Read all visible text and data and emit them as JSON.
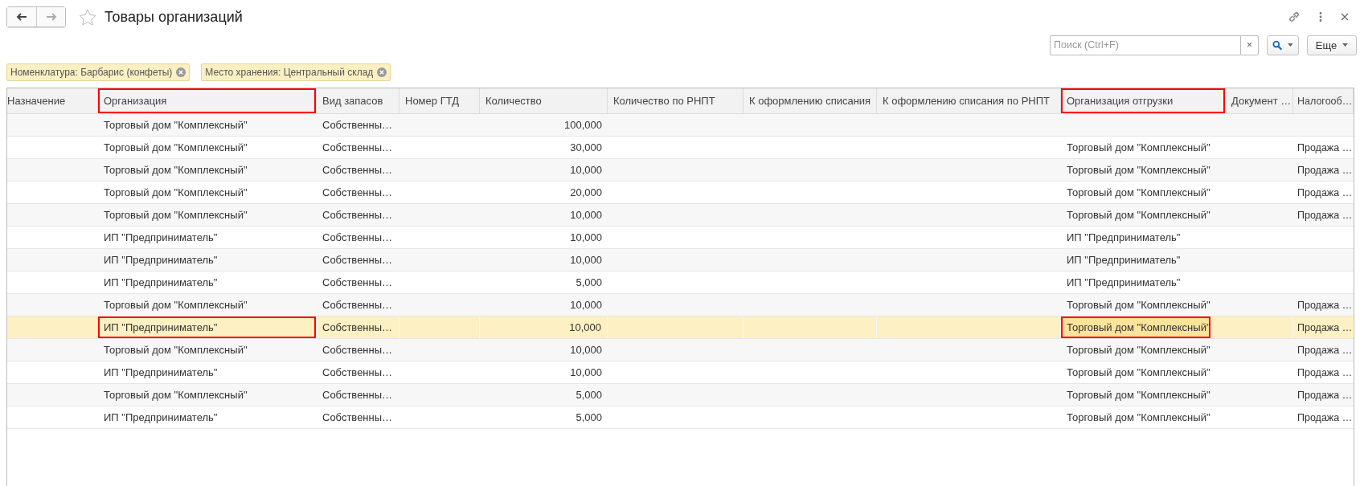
{
  "window": {
    "title": "Товары организаций"
  },
  "search": {
    "placeholder": "Поиск (Ctrl+F)",
    "clear": "×"
  },
  "more_button": "Еще",
  "filters": [
    {
      "label": "Номенклатура: Барбарис (конфеты)"
    },
    {
      "label": "Место хранения: Центральный склад"
    }
  ],
  "table": {
    "columns": [
      {
        "label": "Назначение",
        "annotated": false
      },
      {
        "label": "Организация",
        "annotated": true
      },
      {
        "label": "Вид запасов",
        "annotated": false
      },
      {
        "label": "Номер ГТД",
        "annotated": false
      },
      {
        "label": "Количество",
        "annotated": false
      },
      {
        "label": "Количество по РНПТ",
        "annotated": false
      },
      {
        "label": "К оформлению списания",
        "annotated": false
      },
      {
        "label": "К оформлению списания по РНПТ",
        "annotated": false
      },
      {
        "label": "Организация отгрузки",
        "annotated": true
      },
      {
        "label": "Документ …",
        "annotated": false
      },
      {
        "label": "Налогооб…",
        "annotated": false
      }
    ],
    "rows": [
      {
        "selected": false,
        "annotated": false,
        "organization": "Торговый дом \"Комплексный\"",
        "stock_type": "Собственны…",
        "quantity": "100,000"
      },
      {
        "selected": false,
        "annotated": false,
        "organization": "Торговый дом \"Комплексный\"",
        "stock_type": "Собственны…",
        "quantity": "30,000",
        "shipping_org": "Торговый дом \"Комплексный\"",
        "taxation": "Продажа …"
      },
      {
        "selected": false,
        "annotated": false,
        "organization": "Торговый дом \"Комплексный\"",
        "stock_type": "Собственны…",
        "quantity": "10,000",
        "shipping_org": "Торговый дом \"Комплексный\"",
        "taxation": "Продажа …"
      },
      {
        "selected": false,
        "annotated": false,
        "organization": "Торговый дом \"Комплексный\"",
        "stock_type": "Собственны…",
        "quantity": "20,000",
        "shipping_org": "Торговый дом \"Комплексный\"",
        "taxation": "Продажа …"
      },
      {
        "selected": false,
        "annotated": false,
        "organization": "Торговый дом \"Комплексный\"",
        "stock_type": "Собственны…",
        "quantity": "10,000",
        "shipping_org": "Торговый дом \"Комплексный\"",
        "taxation": "Продажа …"
      },
      {
        "selected": false,
        "annotated": false,
        "organization": "ИП \"Предприниматель\"",
        "stock_type": "Собственны…",
        "quantity": "10,000",
        "shipping_org": "ИП \"Предприниматель\""
      },
      {
        "selected": false,
        "annotated": false,
        "organization": "ИП \"Предприниматель\"",
        "stock_type": "Собственны…",
        "quantity": "10,000",
        "shipping_org": "ИП \"Предприниматель\""
      },
      {
        "selected": false,
        "annotated": false,
        "organization": "ИП \"Предприниматель\"",
        "stock_type": "Собственны…",
        "quantity": "5,000",
        "shipping_org": "ИП \"Предприниматель\""
      },
      {
        "selected": false,
        "annotated": false,
        "organization": "Торговый дом \"Комплексный\"",
        "stock_type": "Собственны…",
        "quantity": "10,000",
        "shipping_org": "Торговый дом \"Комплексный\"",
        "taxation": "Продажа …"
      },
      {
        "selected": true,
        "annotated": true,
        "organization": "ИП \"Предприниматель\"",
        "stock_type": "Собственны…",
        "quantity": "10,000",
        "shipping_org": "Торговый дом \"Комплексный\"",
        "taxation": "Продажа …"
      },
      {
        "selected": false,
        "annotated": false,
        "organization": "Торговый дом \"Комплексный\"",
        "stock_type": "Собственны…",
        "quantity": "10,000",
        "shipping_org": "Торговый дом \"Комплексный\"",
        "taxation": "Продажа …"
      },
      {
        "selected": false,
        "annotated": false,
        "organization": "ИП \"Предприниматель\"",
        "stock_type": "Собственны…",
        "quantity": "10,000",
        "shipping_org": "Торговый дом \"Комплексный\"",
        "taxation": "Продажа …"
      },
      {
        "selected": false,
        "annotated": false,
        "organization": "Торговый дом \"Комплексный\"",
        "stock_type": "Собственны…",
        "quantity": "5,000",
        "shipping_org": "Торговый дом \"Комплексный\"",
        "taxation": "Продажа …"
      },
      {
        "selected": false,
        "annotated": false,
        "organization": "ИП \"Предприниматель\"",
        "stock_type": "Собственны…",
        "quantity": "5,000",
        "shipping_org": "Торговый дом \"Комплексный\"",
        "taxation": "Продажа …"
      }
    ]
  }
}
